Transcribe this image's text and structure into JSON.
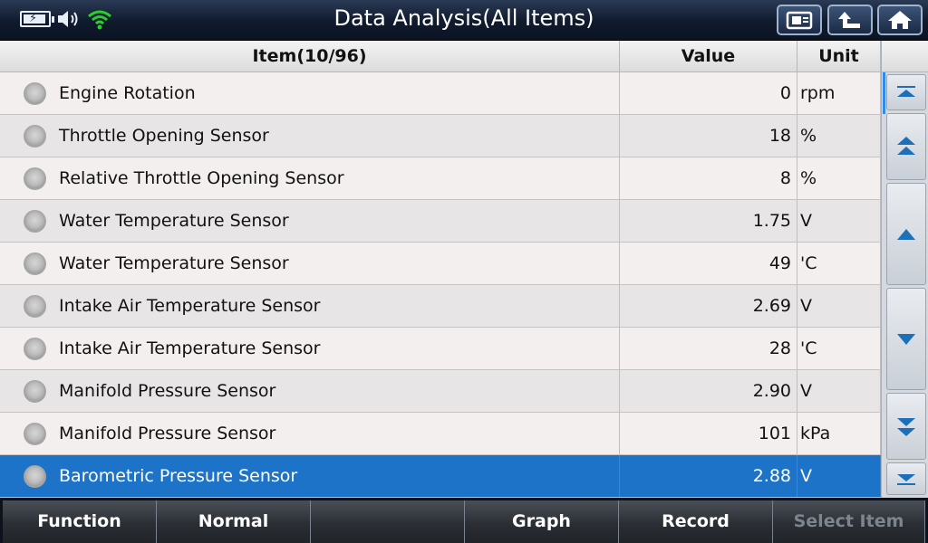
{
  "header": {
    "title": "Data Analysis(All Items)",
    "status_icons": [
      "battery-icon",
      "volume-icon",
      "wifi-icon"
    ],
    "buttons": [
      "screenshot-icon",
      "back-icon",
      "home-icon"
    ]
  },
  "table": {
    "columns": {
      "item": "Item(10/96)",
      "value": "Value",
      "unit": "Unit"
    },
    "rows": [
      {
        "name": "Engine Rotation",
        "value": "0",
        "unit": "rpm"
      },
      {
        "name": "Throttle Opening Sensor",
        "value": "18",
        "unit": "%"
      },
      {
        "name": "Relative Throttle Opening Sensor",
        "value": "8",
        "unit": "%"
      },
      {
        "name": "Water Temperature Sensor",
        "value": "1.75",
        "unit": "V"
      },
      {
        "name": "Water Temperature Sensor",
        "value": "49",
        "unit": "'C"
      },
      {
        "name": "Intake Air Temperature Sensor",
        "value": "2.69",
        "unit": "V"
      },
      {
        "name": "Intake Air Temperature Sensor",
        "value": "28",
        "unit": "'C"
      },
      {
        "name": "Manifold Pressure Sensor",
        "value": "2.90",
        "unit": "V"
      },
      {
        "name": "Manifold Pressure Sensor",
        "value": "101",
        "unit": "kPa"
      },
      {
        "name": "Barometric Pressure Sensor",
        "value": "2.88",
        "unit": "V"
      }
    ],
    "selected_index": 9
  },
  "scrollbar": {
    "buttons": [
      "scroll-top-icon",
      "page-up-icon",
      "line-up-icon",
      "line-down-icon",
      "page-down-icon",
      "scroll-bottom-icon"
    ]
  },
  "footer": {
    "function": "Function",
    "normal": "Normal",
    "blank": "",
    "graph": "Graph",
    "record": "Record",
    "select_item": "Select Item"
  },
  "colors": {
    "selected_row": "#1c73c7",
    "title_bar": "#0f1a2c",
    "wifi": "#2ad02a"
  }
}
